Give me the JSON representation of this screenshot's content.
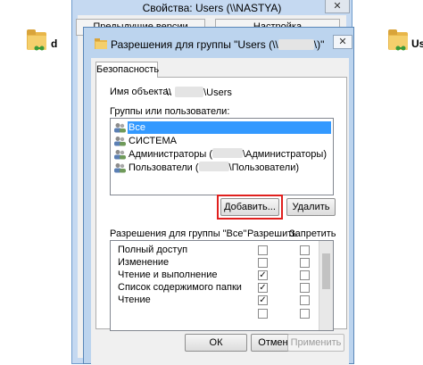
{
  "desktop": {
    "left_folder_label": "d",
    "right_folder_label": "Users"
  },
  "properties_window": {
    "title": "Свойства: Users (\\\\NASTYA)",
    "close_glyph": "✕",
    "tabs": [
      "Предыдущие версии",
      "Настройка"
    ]
  },
  "dialog": {
    "title": "Разрешения для группы \"Users (\\\\",
    "title_end": "\\)\"",
    "close_glyph": "✕",
    "tab": "Безопасность",
    "object_name_label": "Имя объекта:",
    "object_name_prefix": "\\\\",
    "object_name_suffix": "\\Users",
    "groups_label": "Группы или пользователи:",
    "groups": [
      {
        "name": "Все",
        "selected": true
      },
      {
        "name": "СИСТЕМА",
        "selected": false
      },
      {
        "name_prefix": "Администраторы (",
        "name_suffix": "\\Администраторы)",
        "selected": false
      },
      {
        "name_prefix": "Пользователи (",
        "name_suffix": "\\Пользователи)",
        "selected": false
      }
    ],
    "add_button": "Добавить...",
    "remove_button": "Удалить",
    "permissions_label": "Разрешения для группы \"Все\"",
    "allow_header": "Разрешить",
    "deny_header": "Запретить",
    "permissions": [
      {
        "name": "Полный доступ",
        "allow": false,
        "deny": false
      },
      {
        "name": "Изменение",
        "allow": false,
        "deny": false
      },
      {
        "name": "Чтение и выполнение",
        "allow": true,
        "deny": false
      },
      {
        "name": "Список содержимого папки",
        "allow": true,
        "deny": false
      },
      {
        "name": "Чтение",
        "allow": true,
        "deny": false
      }
    ],
    "ok_button": "ОК",
    "cancel_button": "Отмена",
    "apply_button": "Применить"
  },
  "colors": {
    "selection": "#3399ff",
    "highlight_border": "#e0201e",
    "window_frame": "#bcd4ee"
  }
}
